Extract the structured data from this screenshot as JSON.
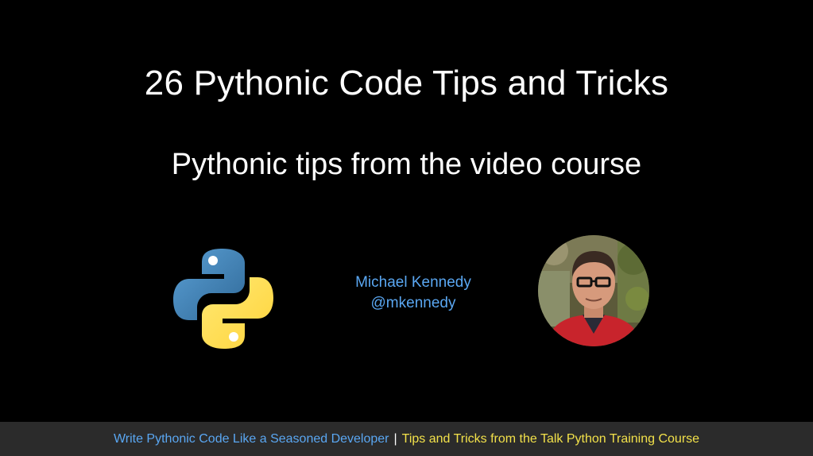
{
  "slide": {
    "title": "26 Pythonic Code Tips and Tricks",
    "subtitle": "Pythonic tips from the video course",
    "author": {
      "name": "Michael Kennedy",
      "handle": "@mkennedy"
    },
    "logo_icon": "python-logo-icon",
    "avatar_icon": "author-photo"
  },
  "footer": {
    "course_title": "Write Pythonic Code Like a Seasoned Developer",
    "separator": "|",
    "tagline": "Tips and Tricks from the Talk Python Training Course"
  },
  "colors": {
    "background": "#000000",
    "title_text": "#ffffff",
    "author_text": "#5aa7f2",
    "footer_background": "#2b2b2b",
    "footer_course": "#5aa7f2",
    "footer_tagline": "#f2e14a",
    "python_blue": "#3b73a8",
    "python_yellow": "#fdd43b"
  }
}
